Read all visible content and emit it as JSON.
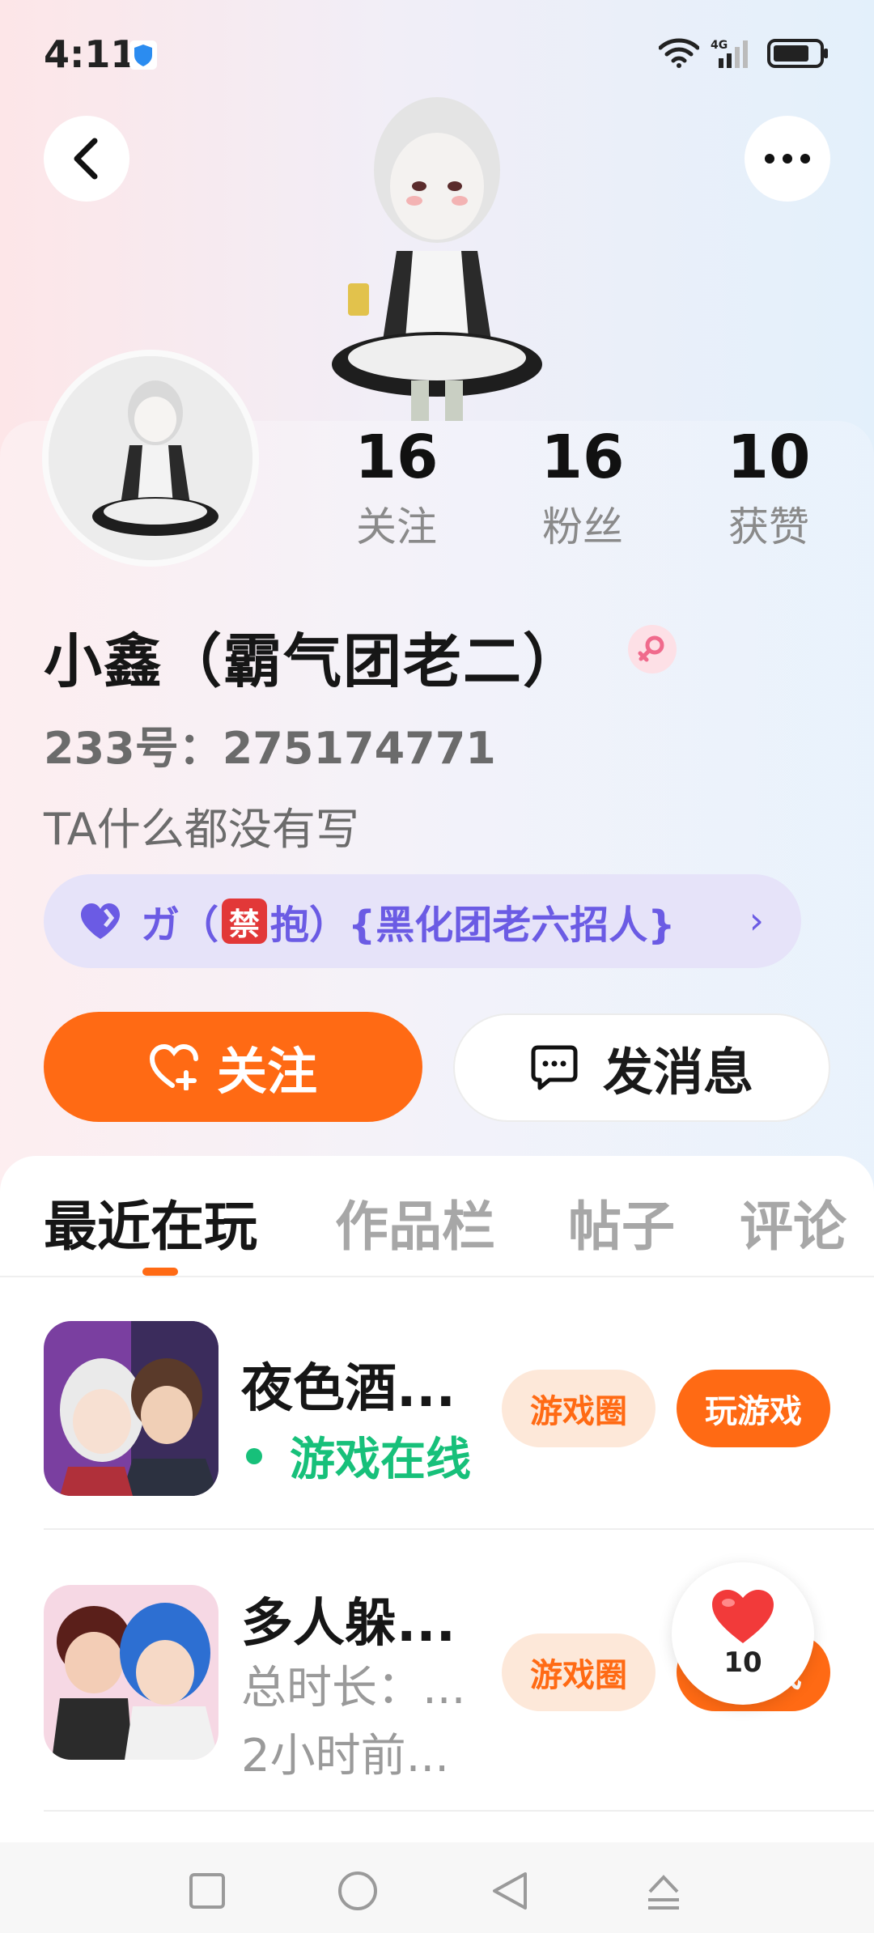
{
  "status_bar": {
    "time": "4:11",
    "network": "4G",
    "battery_level": 0.8
  },
  "profile": {
    "stats": [
      {
        "value": "16",
        "label": "关注"
      },
      {
        "value": "16",
        "label": "粉丝"
      },
      {
        "value": "10",
        "label": "获赞"
      }
    ],
    "nickname": "小鑫（霸气团老二）",
    "gender_icon": "female-symbol-icon",
    "id_label": "233号：275174771",
    "bio": "TA什么都没有写",
    "group": {
      "prefix": "ガ（",
      "ban": "禁",
      "suffix": "抱）{黑化团老六招人}",
      "chevron": "›"
    }
  },
  "actions": {
    "follow_label": "关注",
    "message_label": "发消息"
  },
  "tabs": [
    "最近在玩",
    "作品栏",
    "帖子",
    "评论"
  ],
  "active_tab": 0,
  "games": [
    {
      "title": "夜色酒...",
      "status": "游戏在线",
      "circle_label": "游戏圈",
      "play_label": "玩游戏"
    },
    {
      "title": "多人躲...",
      "duration": "总时长：...",
      "last_played": "2小时前...",
      "circle_label": "游戏圈",
      "play_label": "玩游戏"
    }
  ],
  "like_bubble": {
    "count": "10"
  },
  "colors": {
    "accent": "#ff6a14",
    "online": "#17c07a",
    "group_purple": "#6b5be4",
    "ban_red": "#e23838"
  }
}
